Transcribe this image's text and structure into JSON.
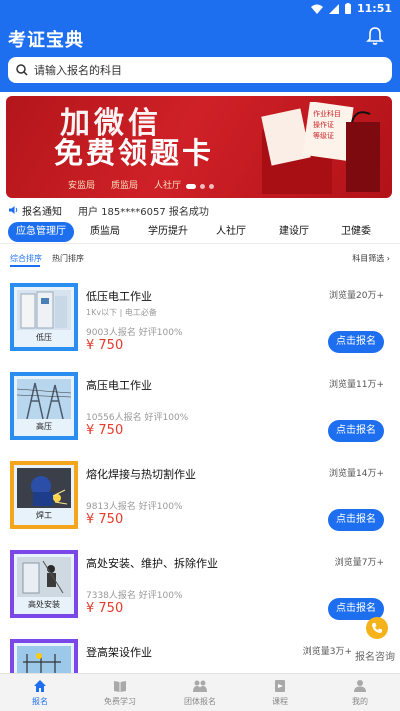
{
  "status_bar": {
    "time": "11:51"
  },
  "header": {
    "title": "考证宝典"
  },
  "search": {
    "placeholder": "请输入报名的科目"
  },
  "banner": {
    "line1": "加微信",
    "line2": "免费领题卡",
    "tags": [
      "安监局",
      "质监局",
      "人社厅"
    ],
    "paper_tags": [
      "作业科目",
      "操作证",
      "等级证"
    ]
  },
  "notice": {
    "label": "报名通知",
    "message": "用户 185****6057 报名成功"
  },
  "categories": [
    "应急管理厅",
    "质监局",
    "学历提升",
    "人社厅",
    "建设厅",
    "卫健委"
  ],
  "sort": {
    "composite": "综合排序",
    "popular": "热门排序",
    "filter": "科目筛选 ›"
  },
  "courses": [
    {
      "title": "低压电工作业",
      "subtitle": "1Kv以下 | 电工必备",
      "meta": "9003人报名   好评100%",
      "price": "¥ 750",
      "views": "浏览量20万+",
      "button": "点击报名",
      "thumb_caption": "低压",
      "border": "#2a8ef0"
    },
    {
      "title": "高压电工作业",
      "subtitle": "",
      "meta": "10556人报名   好评100%",
      "price": "¥ 750",
      "views": "浏览量11万+",
      "button": "点击报名",
      "thumb_caption": "高压",
      "border": "#2a8ef0"
    },
    {
      "title": "熔化焊接与热切割作业",
      "subtitle": "",
      "meta": "9813人报名   好评100%",
      "price": "¥ 750",
      "views": "浏览量14万+",
      "button": "点击报名",
      "thumb_caption": "焊工",
      "border": "#f5a51b"
    },
    {
      "title": "高处安装、维护、拆除作业",
      "subtitle": "",
      "meta": "7338人报名   好评100%",
      "price": "¥ 750",
      "views": "浏览量7万+",
      "button": "点击报名",
      "thumb_caption": "高处安装",
      "border": "#7a47e8"
    },
    {
      "title": "登高架设作业",
      "subtitle": "",
      "meta": "",
      "price": "",
      "views": "浏览量3万+",
      "button": "",
      "thumb_caption": "",
      "border": "#7a47e8"
    }
  ],
  "help": {
    "label": "报名咨询"
  },
  "bottom_nav": [
    {
      "label": "报名",
      "icon": "home-icon"
    },
    {
      "label": "免费学习",
      "icon": "book-icon"
    },
    {
      "label": "团体报名",
      "icon": "group-icon"
    },
    {
      "label": "课程",
      "icon": "course-icon"
    },
    {
      "label": "我的",
      "icon": "user-icon"
    }
  ],
  "colors": {
    "primary": "#1e6ff0",
    "price": "#e43b2d",
    "banner": "#cf2027"
  }
}
